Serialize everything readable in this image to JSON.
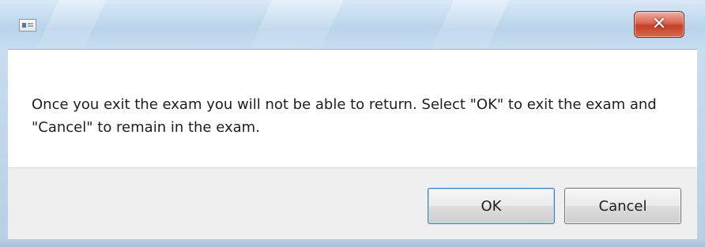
{
  "dialog": {
    "message": "Once you exit the exam you will not be able to return. Select \"OK\" to exit the exam and \"Cancel\" to remain in the exam.",
    "buttons": {
      "ok_label": "OK",
      "cancel_label": "Cancel"
    }
  },
  "titlebar": {
    "app_icon": "window-app-icon",
    "close_icon_glyph": "✕"
  },
  "colors": {
    "close_button_red": "#c33f26",
    "titlebar_blue": "#c5dcf0",
    "content_background": "#ffffff",
    "footer_background": "#efefef"
  }
}
